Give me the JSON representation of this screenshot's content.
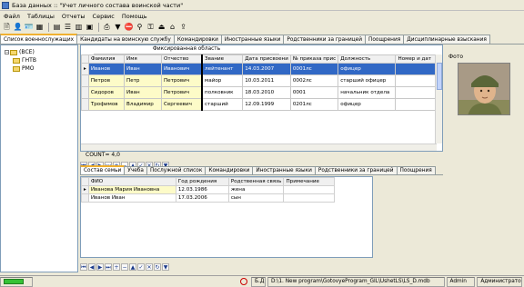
{
  "window": {
    "title": "База данных :: \"Учет личного состава воинской части\""
  },
  "menu": [
    "Файл",
    "Таблицы",
    "Отчеты",
    "Сервис",
    "Помощь"
  ],
  "main_tabs": [
    "Список военнослужащих",
    "Кандидаты на воинскую службу",
    "Командировки",
    "Иностранные языки",
    "Родственники за границей",
    "Поощрения",
    "Дисциплинарные взыскания"
  ],
  "tree": {
    "items": [
      {
        "label": "(ВСЕ)"
      },
      {
        "label": "ГНТВ"
      },
      {
        "label": "РМО"
      }
    ]
  },
  "grid": {
    "fixed_caption": "Фиксированная область",
    "columns": [
      "Фамилия",
      "Имя",
      "Отчество",
      "Звание",
      "Дата присвоени",
      "№ приказа прис",
      "Должность",
      "Номер и дат"
    ],
    "rows": [
      [
        "Иванов",
        "Иван",
        "Иванович",
        "лейтенант",
        "14.03.2007",
        "0001лс",
        "офицер",
        ""
      ],
      [
        "Петров",
        "Петр",
        "Петрович",
        "майор",
        "10.03.2011",
        "0002лс",
        "старший офицер",
        ""
      ],
      [
        "Сидоров",
        "Иван",
        "Петрович",
        "полковник",
        "18.03.2010",
        "0001",
        "начальник отдела",
        ""
      ],
      [
        "Трофимов",
        "Владимир",
        "Сергеевич",
        "старший",
        "12.09.1999",
        "0201лс",
        "офицер",
        ""
      ]
    ],
    "selected_row": 0
  },
  "count_label": "COUNT= 4,0",
  "sub_tabs": [
    "Состав семьи",
    "Учеба",
    "Послужной список",
    "Командировки",
    "Иностранные языки",
    "Родственники за границей",
    "Поощрения"
  ],
  "subgrid": {
    "columns": [
      "ФИО",
      "Год рождения",
      "Родственная связь",
      "Примечание"
    ],
    "rows": [
      [
        "Иванова Мария Ивановна",
        "12.03.1986",
        "жена",
        ""
      ],
      [
        "Иванов Иван",
        "17.03.2006",
        "сын",
        ""
      ]
    ]
  },
  "photo_label": "Фото",
  "status": {
    "db_label": "Б.Д.",
    "db_path": "D:\\1. New program\\GotovyeProgram_GIL\\UshetLS\\LS_D.mdb",
    "user": "Admin",
    "role": "Администратор"
  },
  "colors": {
    "selection": "#3168c5",
    "fixed_area": "#fdfbc8",
    "tab_accent": "#f0b030"
  }
}
